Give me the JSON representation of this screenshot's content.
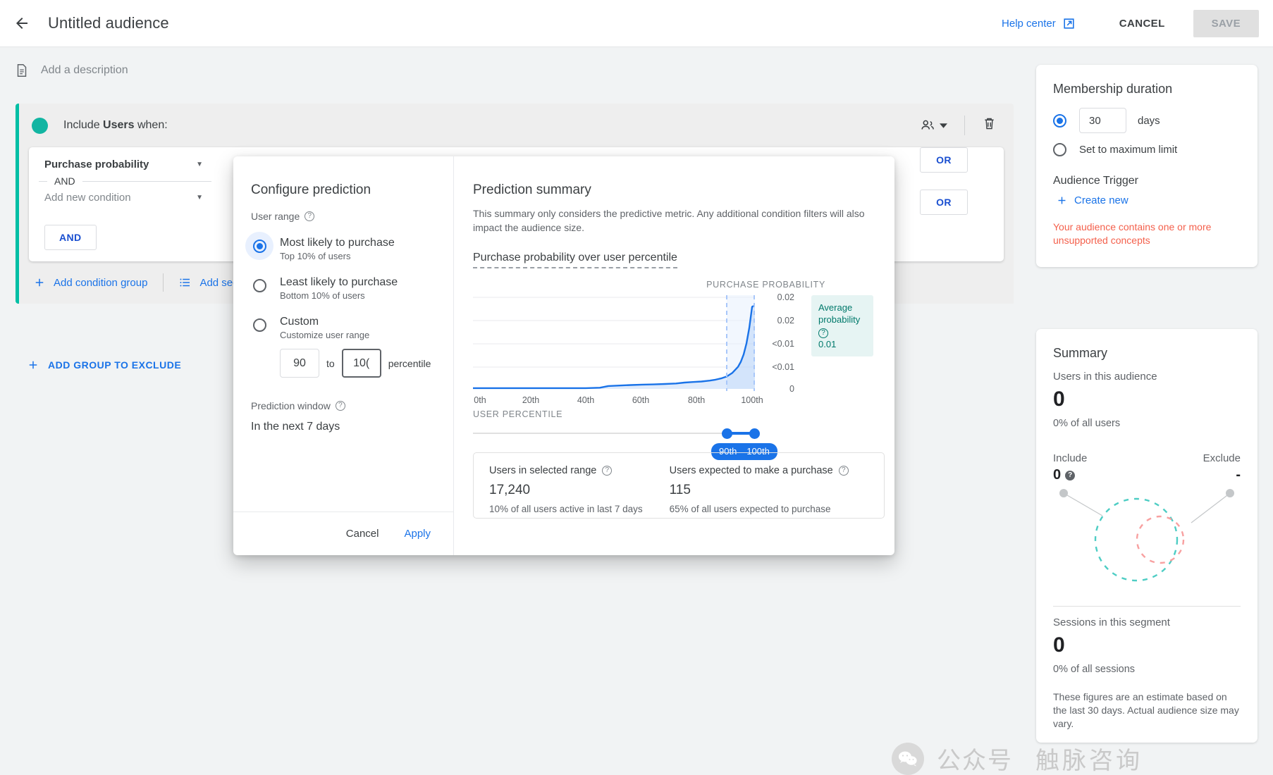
{
  "topbar": {
    "title": "Untitled audience",
    "back_icon": "arrow-left-icon",
    "help_center": "Help center",
    "external_link_icon": "external-link-icon",
    "cancel": "CANCEL",
    "save": "SAVE"
  },
  "description": {
    "icon": "document-icon",
    "placeholder": "Add a description"
  },
  "builder": {
    "include_prefix": "Include ",
    "include_bold": "Users",
    "include_suffix": " when:",
    "people_icon": "people-icon",
    "dropdown_caret_icon": "chevron-down-icon",
    "delete_icon": "trash-icon",
    "rows": [
      {
        "label": "Purchase probability",
        "or": "OR",
        "muted": false
      },
      {
        "label": "Add new condition",
        "or": "OR",
        "muted": true
      }
    ],
    "and_divider": "AND",
    "and_button": "AND",
    "add_condition_group": "Add condition group",
    "add_sequence": "Add sequence",
    "add_group_to_exclude": "ADD GROUP TO EXCLUDE"
  },
  "modal": {
    "left": {
      "title": "Configure prediction",
      "user_range_label": "User range",
      "options": [
        {
          "main": "Most likely to purchase",
          "sub": "Top 10% of users",
          "selected": true
        },
        {
          "main": "Least likely to purchase",
          "sub": "Bottom 10% of users",
          "selected": false
        },
        {
          "main": "Custom",
          "sub": "Customize user range",
          "selected": false
        }
      ],
      "range_from": "90",
      "range_to": "10(",
      "to_label": "to",
      "percentile_label": "percentile",
      "prediction_window_label": "Prediction window",
      "prediction_window_value": "In the next 7 days",
      "cancel": "Cancel",
      "apply": "Apply"
    },
    "right": {
      "title": "Prediction summary",
      "description": "This summary only considers the predictive metric. Any additional condition filters will also impact the audience size.",
      "chart_caption": "Purchase probability over user percentile",
      "avg_label": "Average probability",
      "avg_value": "0.01",
      "slider_chip_left": "90th",
      "slider_chip_right": "100th",
      "stats": [
        {
          "label": "Users in selected range",
          "value": "17,240",
          "sub": "10% of all users active in last 7 days"
        },
        {
          "label": "Users expected to make a purchase",
          "value": "115",
          "sub": "65% of all users expected to purchase"
        }
      ]
    }
  },
  "chart_data": {
    "type": "area",
    "title": "Purchase probability over user percentile",
    "xlabel": "USER PERCENTILE",
    "ylabel": "PURCHASE PROBABILITY",
    "x_ticks": [
      "0th",
      "20th",
      "40th",
      "60th",
      "80th",
      "100th"
    ],
    "y_ticks": [
      "0.02",
      "0.02",
      "<0.01",
      "<0.01",
      "0"
    ],
    "ylim": [
      0,
      0.025
    ],
    "xlim": [
      0,
      100
    ],
    "grid": true,
    "legend": null,
    "highlight_range": [
      90,
      100
    ],
    "annotation": {
      "label": "Average probability",
      "value": "0.01"
    },
    "x": [
      0,
      5,
      10,
      15,
      20,
      25,
      30,
      35,
      40,
      45,
      48,
      52,
      56,
      60,
      64,
      68,
      72,
      75,
      78,
      81,
      84,
      86,
      88,
      90,
      92,
      94,
      95,
      96,
      97,
      98,
      99,
      100
    ],
    "values": [
      0.0002,
      0.0002,
      0.0002,
      0.0002,
      0.0002,
      0.0002,
      0.0002,
      0.0002,
      0.0002,
      0.0003,
      0.0006,
      0.0007,
      0.0008,
      0.0009,
      0.0009,
      0.001,
      0.0011,
      0.0013,
      0.0014,
      0.0015,
      0.0017,
      0.0019,
      0.0022,
      0.0026,
      0.0034,
      0.0047,
      0.0058,
      0.0074,
      0.0098,
      0.0132,
      0.0178,
      0.0208
    ]
  },
  "sidebar": {
    "membership": {
      "title": "Membership duration",
      "days_value": "30",
      "days_label": "days",
      "max_limit_label": "Set to maximum limit",
      "trigger_title": "Audience Trigger",
      "create_new": "Create new",
      "plus_icon": "plus-icon",
      "warning": "Your audience contains one or more unsupported concepts"
    },
    "summary": {
      "title": "Summary",
      "users_label": "Users in this audience",
      "users_value": "0",
      "users_pct": "0% of all users",
      "include_label": "Include",
      "exclude_label": "Exclude",
      "include_value": "0",
      "exclude_value": "-",
      "sessions_label": "Sessions in this segment",
      "sessions_value": "0",
      "sessions_pct": "0% of all sessions",
      "note": "These figures are an estimate based on the last 30 days. Actual audience size may vary."
    }
  },
  "watermark": {
    "text1": "公众号",
    "text2": "触脉咨询"
  },
  "colors": {
    "accent_blue": "#1a73e8",
    "teal": "#00bfa5",
    "warning_red": "#f4604c",
    "chart_line": "#1a73e8"
  }
}
